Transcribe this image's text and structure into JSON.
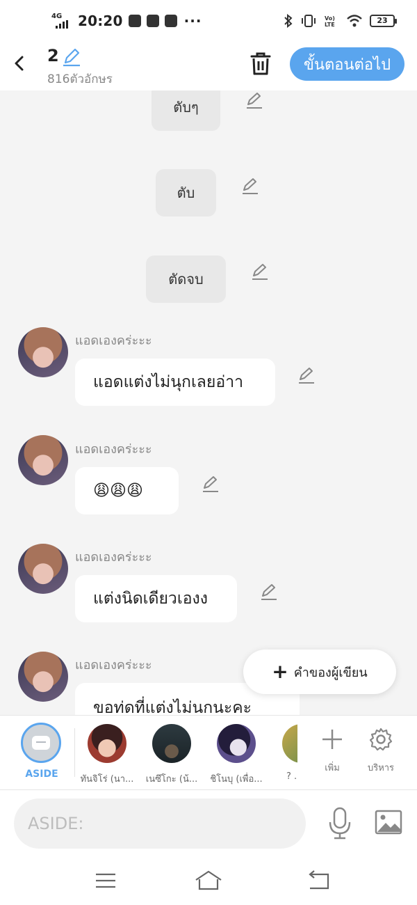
{
  "status_bar": {
    "network": "4G",
    "time": "20:20",
    "more": "···",
    "volte": "Vo) LTE",
    "battery": "23"
  },
  "header": {
    "title": "2",
    "char_count": "816ตัวอักษร",
    "next_label": "ขั้นตอนต่อไป"
  },
  "chat": {
    "center_messages": [
      "ตับๆ",
      "ตับ",
      "ตัดจบ"
    ],
    "messages": [
      {
        "sender": "แอดเองคร่ะะะ",
        "text": "แอดแต่งไม่นุกเลยอ่าา"
      },
      {
        "sender": "แอดเองคร่ะะะ",
        "text": "😩😩😩"
      },
      {
        "sender": "แอดเองคร่ะะะ",
        "text": "แต่งนิดเดียวเองง"
      },
      {
        "sender": "แอดเองคร่ะะะ",
        "text": "ขอท่ดที่แต่งไม่นกนะคะ"
      }
    ]
  },
  "fab": {
    "label": "คำของผู้เขียน"
  },
  "characters": {
    "aside_label": "ASIDE",
    "items": [
      {
        "name": "ทันจิโร่ (นา..."
      },
      {
        "name": "เนซึโกะ (น้..."
      },
      {
        "name": "ชิโนบุ (เพื่อ..."
      },
      {
        "name": "? ..."
      }
    ],
    "add_label": "เพิ่ม",
    "manage_label": "บริหาร"
  },
  "input": {
    "placeholder": "ASIDE:"
  },
  "colors": {
    "accent": "#5aa5ee",
    "background": "#f4f4f4"
  }
}
